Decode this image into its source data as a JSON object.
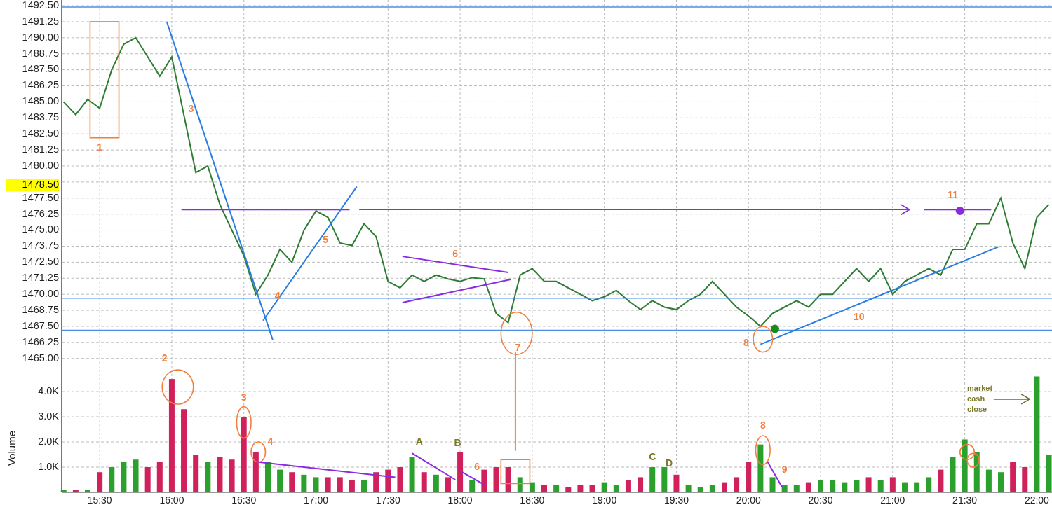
{
  "price_pane": {
    "price_marker": "1478.50",
    "labels": [
      {
        "text": "1",
        "color": "#f08040"
      },
      {
        "text": "2",
        "color": "#f08040"
      },
      {
        "text": "3",
        "color": "#f08040"
      },
      {
        "text": "4",
        "color": "#f08040"
      },
      {
        "text": "5",
        "color": "#f08040"
      },
      {
        "text": "6",
        "color": "#f08040"
      },
      {
        "text": "7",
        "color": "#f08040"
      },
      {
        "text": "8",
        "color": "#f08040"
      },
      {
        "text": "10",
        "color": "#f08040"
      },
      {
        "text": "11",
        "color": "#f08040"
      }
    ],
    "chart_data": {
      "type": "line",
      "grid": true,
      "x": [
        915,
        920,
        925,
        930,
        935,
        940,
        945,
        950,
        955,
        960,
        965,
        970,
        975,
        980,
        985,
        990,
        995,
        1000,
        1005,
        1010,
        1015,
        1020,
        1025,
        1030,
        1035,
        1040,
        1045,
        1050,
        1055,
        1060,
        1065,
        1070,
        1075,
        1080,
        1085,
        1090,
        1095,
        1100,
        1105,
        1110,
        1115,
        1120,
        1125,
        1130,
        1135,
        1140,
        1145,
        1150,
        1155,
        1160,
        1165,
        1170,
        1175,
        1180,
        1185,
        1190,
        1195,
        1200,
        1205,
        1210,
        1215,
        1220,
        1225,
        1230,
        1235,
        1240,
        1245,
        1250,
        1255,
        1260,
        1265,
        1270,
        1275,
        1280,
        1285,
        1290,
        1295,
        1300,
        1305,
        1310,
        1315,
        1320,
        1325
      ],
      "series": [
        {
          "color": "#2e7d32",
          "values": [
            1485.0,
            1484.0,
            1485.2,
            1484.5,
            1487.5,
            1489.5,
            1490.0,
            1488.5,
            1487.0,
            1488.5,
            1484.0,
            1479.5,
            1480.0,
            1477.0,
            1475.0,
            1473.0,
            1470.0,
            1471.5,
            1473.5,
            1472.5,
            1475.0,
            1476.5,
            1476.0,
            1474.0,
            1473.8,
            1475.5,
            1474.5,
            1471.0,
            1470.5,
            1471.5,
            1471.0,
            1471.5,
            1471.2,
            1471.0,
            1471.3,
            1471.2,
            1468.5,
            1467.8,
            1471.5,
            1472.0,
            1471.0,
            1471.0,
            1470.5,
            1470.0,
            1469.5,
            1469.8,
            1470.3,
            1469.5,
            1468.8,
            1469.5,
            1469.0,
            1468.8,
            1469.5,
            1470.0,
            1471.0,
            1470.0,
            1469.0,
            1468.3,
            1467.5,
            1468.5,
            1469.0,
            1469.5,
            1469.0,
            1470.0,
            1470.0,
            1471.0,
            1472.0,
            1471.0,
            1472.0,
            1470.0,
            1471.0,
            1471.5,
            1472.0,
            1471.5,
            1473.5,
            1473.5,
            1475.5,
            1475.5,
            1477.5,
            1474.0,
            1472.0,
            1476.0,
            1477.0
          ]
        }
      ],
      "xlim": [
        914.2,
        1326.3
      ],
      "ylim": [
        1464.44,
        1492.94
      ],
      "yticks": [
        {
          "value": 1492.5,
          "label": "1492.50"
        },
        {
          "value": 1491.25,
          "label": "1491.25"
        },
        {
          "value": 1490,
          "label": "1490.00"
        },
        {
          "value": 1488.75,
          "label": "1488.75"
        },
        {
          "value": 1487.5,
          "label": "1487.50"
        },
        {
          "value": 1486.25,
          "label": "1486.25"
        },
        {
          "value": 1485,
          "label": "1485.00"
        },
        {
          "value": 1483.75,
          "label": "1483.75"
        },
        {
          "value": 1482.5,
          "label": "1482.50"
        },
        {
          "value": 1481.25,
          "label": "1481.25"
        },
        {
          "value": 1480,
          "label": "1480.00"
        },
        {
          "value": 1477.5,
          "label": "1477.50"
        },
        {
          "value": 1476.25,
          "label": "1476.25"
        },
        {
          "value": 1475,
          "label": "1475.00"
        },
        {
          "value": 1473.75,
          "label": "1473.75"
        },
        {
          "value": 1472.5,
          "label": "1472.50"
        },
        {
          "value": 1471.25,
          "label": "1471.25"
        },
        {
          "value": 1470,
          "label": "1470.00"
        },
        {
          "value": 1468.75,
          "label": "1468.75"
        },
        {
          "value": 1467.5,
          "label": "1467.50"
        },
        {
          "value": 1466.25,
          "label": "1466.25"
        },
        {
          "value": 1465,
          "label": "1465.00"
        }
      ]
    }
  },
  "volume_pane": {
    "labels": [
      {
        "text": "3",
        "color": "#f08040"
      },
      {
        "text": "4",
        "color": "#f08040"
      },
      {
        "text": "A",
        "color": "#7a7a2a"
      },
      {
        "text": "B",
        "color": "#7a7a2a"
      },
      {
        "text": "6",
        "color": "#f08040"
      },
      {
        "text": "C",
        "color": "#7a7a2a"
      },
      {
        "text": "D",
        "color": "#7a7a2a"
      },
      {
        "text": "8",
        "color": "#f08040"
      },
      {
        "text": "9",
        "color": "#f08040"
      },
      {
        "text": "market cash close",
        "color": "#7a7a2a"
      }
    ],
    "chart_data": {
      "type": "bar",
      "stacked": true,
      "grid": true,
      "ylabel": "Volume",
      "x": [
        915,
        920,
        925,
        930,
        935,
        940,
        945,
        950,
        955,
        960,
        965,
        970,
        975,
        980,
        985,
        990,
        995,
        1000,
        1005,
        1010,
        1015,
        1020,
        1025,
        1030,
        1035,
        1040,
        1045,
        1050,
        1055,
        1060,
        1065,
        1070,
        1075,
        1080,
        1085,
        1090,
        1095,
        1100,
        1105,
        1110,
        1115,
        1120,
        1125,
        1130,
        1135,
        1140,
        1145,
        1150,
        1155,
        1160,
        1165,
        1170,
        1175,
        1180,
        1185,
        1190,
        1195,
        1200,
        1205,
        1210,
        1215,
        1220,
        1225,
        1230,
        1235,
        1240,
        1245,
        1250,
        1255,
        1260,
        1265,
        1270,
        1275,
        1280,
        1285,
        1290,
        1295,
        1300,
        1305,
        1310,
        1315,
        1320,
        1325
      ],
      "series": [
        {
          "color": "#2ca02c",
          "values": [
            0.1,
            null,
            0.1,
            null,
            1.0,
            1.2,
            1.3,
            null,
            null,
            null,
            null,
            null,
            1.2,
            null,
            null,
            null,
            null,
            1.2,
            0.9,
            null,
            0.7,
            0.6,
            null,
            null,
            null,
            0.5,
            null,
            null,
            null,
            1.4,
            null,
            0.7,
            null,
            null,
            0.5,
            null,
            null,
            null,
            0.6,
            0.4,
            null,
            0.3,
            null,
            null,
            null,
            0.4,
            0.3,
            null,
            null,
            1.0,
            1.0,
            null,
            0.3,
            0.2,
            0.3,
            null,
            null,
            null,
            1.9,
            0.6,
            0.3,
            0.3,
            null,
            0.5,
            0.5,
            0.4,
            0.5,
            null,
            0.5,
            null,
            0.4,
            0.4,
            0.6,
            null,
            1.4,
            2.1,
            1.6,
            0.9,
            0.8,
            null,
            null,
            4.6,
            1.5
          ]
        },
        {
          "color": "#d0215b",
          "values": [
            null,
            0.1,
            null,
            0.8,
            null,
            null,
            null,
            1.0,
            1.2,
            4.5,
            3.3,
            1.5,
            null,
            1.4,
            1.3,
            3.0,
            1.6,
            null,
            null,
            0.8,
            null,
            null,
            0.6,
            0.6,
            0.5,
            null,
            0.8,
            0.9,
            1.0,
            null,
            0.8,
            null,
            0.6,
            1.6,
            null,
            0.9,
            1.0,
            1.0,
            null,
            null,
            0.3,
            null,
            0.2,
            0.3,
            0.3,
            null,
            null,
            0.5,
            0.6,
            null,
            null,
            0.7,
            null,
            null,
            null,
            0.4,
            0.6,
            1.2,
            null,
            null,
            null,
            null,
            0.4,
            null,
            null,
            null,
            null,
            0.6,
            null,
            0.6,
            null,
            null,
            null,
            0.9,
            null,
            null,
            null,
            null,
            null,
            1.2,
            1.0,
            null,
            null
          ]
        }
      ],
      "xlim": [
        914.2,
        1326.3
      ],
      "ylim": [
        0,
        5.03
      ],
      "yticks": [
        {
          "value": 1.0,
          "label": "1.0K"
        },
        {
          "value": 2.0,
          "label": "2.0K"
        },
        {
          "value": 3.0,
          "label": "3.0K"
        },
        {
          "value": 4.0,
          "label": "4.0K"
        }
      ],
      "xticks": [
        {
          "value": 930,
          "label": "15:30"
        },
        {
          "value": 960,
          "label": "16:00"
        },
        {
          "value": 990,
          "label": "16:30"
        },
        {
          "value": 1020,
          "label": "17:00"
        },
        {
          "value": 1050,
          "label": "17:30"
        },
        {
          "value": 1080,
          "label": "18:00"
        },
        {
          "value": 1110,
          "label": "18:30"
        },
        {
          "value": 1140,
          "label": "19:00"
        },
        {
          "value": 1170,
          "label": "19:30"
        },
        {
          "value": 1200,
          "label": "20:00"
        },
        {
          "value": 1230,
          "label": "20:30"
        },
        {
          "value": 1260,
          "label": "21:00"
        },
        {
          "value": 1290,
          "label": "21:30"
        },
        {
          "value": 1320,
          "label": "22:00"
        }
      ]
    }
  }
}
